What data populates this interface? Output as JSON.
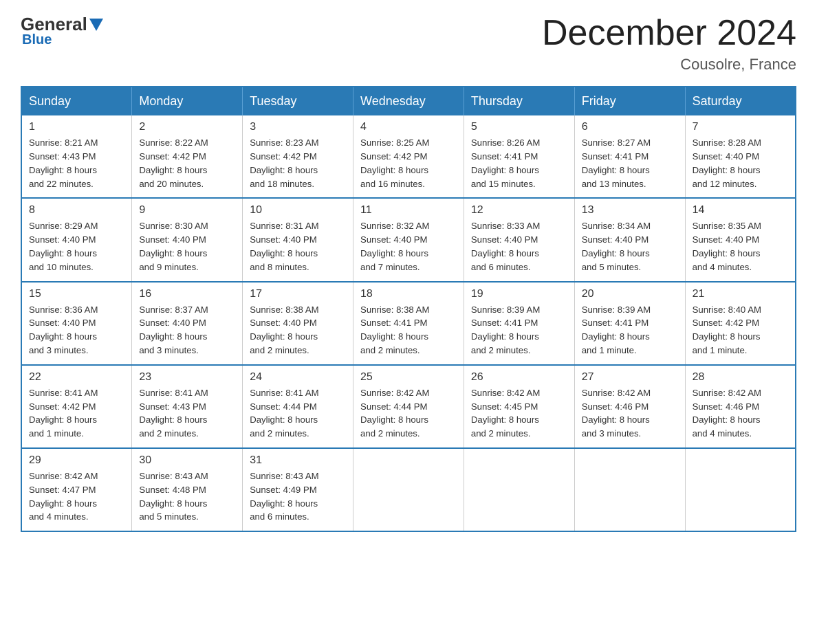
{
  "logo": {
    "general": "General",
    "blue": "Blue"
  },
  "title": "December 2024",
  "location": "Cousolre, France",
  "weekdays": [
    "Sunday",
    "Monday",
    "Tuesday",
    "Wednesday",
    "Thursday",
    "Friday",
    "Saturday"
  ],
  "weeks": [
    [
      {
        "day": "1",
        "sunrise": "8:21 AM",
        "sunset": "4:43 PM",
        "daylight": "8 hours and 22 minutes."
      },
      {
        "day": "2",
        "sunrise": "8:22 AM",
        "sunset": "4:42 PM",
        "daylight": "8 hours and 20 minutes."
      },
      {
        "day": "3",
        "sunrise": "8:23 AM",
        "sunset": "4:42 PM",
        "daylight": "8 hours and 18 minutes."
      },
      {
        "day": "4",
        "sunrise": "8:25 AM",
        "sunset": "4:42 PM",
        "daylight": "8 hours and 16 minutes."
      },
      {
        "day": "5",
        "sunrise": "8:26 AM",
        "sunset": "4:41 PM",
        "daylight": "8 hours and 15 minutes."
      },
      {
        "day": "6",
        "sunrise": "8:27 AM",
        "sunset": "4:41 PM",
        "daylight": "8 hours and 13 minutes."
      },
      {
        "day": "7",
        "sunrise": "8:28 AM",
        "sunset": "4:40 PM",
        "daylight": "8 hours and 12 minutes."
      }
    ],
    [
      {
        "day": "8",
        "sunrise": "8:29 AM",
        "sunset": "4:40 PM",
        "daylight": "8 hours and 10 minutes."
      },
      {
        "day": "9",
        "sunrise": "8:30 AM",
        "sunset": "4:40 PM",
        "daylight": "8 hours and 9 minutes."
      },
      {
        "day": "10",
        "sunrise": "8:31 AM",
        "sunset": "4:40 PM",
        "daylight": "8 hours and 8 minutes."
      },
      {
        "day": "11",
        "sunrise": "8:32 AM",
        "sunset": "4:40 PM",
        "daylight": "8 hours and 7 minutes."
      },
      {
        "day": "12",
        "sunrise": "8:33 AM",
        "sunset": "4:40 PM",
        "daylight": "8 hours and 6 minutes."
      },
      {
        "day": "13",
        "sunrise": "8:34 AM",
        "sunset": "4:40 PM",
        "daylight": "8 hours and 5 minutes."
      },
      {
        "day": "14",
        "sunrise": "8:35 AM",
        "sunset": "4:40 PM",
        "daylight": "8 hours and 4 minutes."
      }
    ],
    [
      {
        "day": "15",
        "sunrise": "8:36 AM",
        "sunset": "4:40 PM",
        "daylight": "8 hours and 3 minutes."
      },
      {
        "day": "16",
        "sunrise": "8:37 AM",
        "sunset": "4:40 PM",
        "daylight": "8 hours and 3 minutes."
      },
      {
        "day": "17",
        "sunrise": "8:38 AM",
        "sunset": "4:40 PM",
        "daylight": "8 hours and 2 minutes."
      },
      {
        "day": "18",
        "sunrise": "8:38 AM",
        "sunset": "4:41 PM",
        "daylight": "8 hours and 2 minutes."
      },
      {
        "day": "19",
        "sunrise": "8:39 AM",
        "sunset": "4:41 PM",
        "daylight": "8 hours and 2 minutes."
      },
      {
        "day": "20",
        "sunrise": "8:39 AM",
        "sunset": "4:41 PM",
        "daylight": "8 hours and 1 minute."
      },
      {
        "day": "21",
        "sunrise": "8:40 AM",
        "sunset": "4:42 PM",
        "daylight": "8 hours and 1 minute."
      }
    ],
    [
      {
        "day": "22",
        "sunrise": "8:41 AM",
        "sunset": "4:42 PM",
        "daylight": "8 hours and 1 minute."
      },
      {
        "day": "23",
        "sunrise": "8:41 AM",
        "sunset": "4:43 PM",
        "daylight": "8 hours and 2 minutes."
      },
      {
        "day": "24",
        "sunrise": "8:41 AM",
        "sunset": "4:44 PM",
        "daylight": "8 hours and 2 minutes."
      },
      {
        "day": "25",
        "sunrise": "8:42 AM",
        "sunset": "4:44 PM",
        "daylight": "8 hours and 2 minutes."
      },
      {
        "day": "26",
        "sunrise": "8:42 AM",
        "sunset": "4:45 PM",
        "daylight": "8 hours and 2 minutes."
      },
      {
        "day": "27",
        "sunrise": "8:42 AM",
        "sunset": "4:46 PM",
        "daylight": "8 hours and 3 minutes."
      },
      {
        "day": "28",
        "sunrise": "8:42 AM",
        "sunset": "4:46 PM",
        "daylight": "8 hours and 4 minutes."
      }
    ],
    [
      {
        "day": "29",
        "sunrise": "8:42 AM",
        "sunset": "4:47 PM",
        "daylight": "8 hours and 4 minutes."
      },
      {
        "day": "30",
        "sunrise": "8:43 AM",
        "sunset": "4:48 PM",
        "daylight": "8 hours and 5 minutes."
      },
      {
        "day": "31",
        "sunrise": "8:43 AM",
        "sunset": "4:49 PM",
        "daylight": "8 hours and 6 minutes."
      },
      null,
      null,
      null,
      null
    ]
  ],
  "labels": {
    "sunrise": "Sunrise: ",
    "sunset": "Sunset: ",
    "daylight": "Daylight: "
  }
}
